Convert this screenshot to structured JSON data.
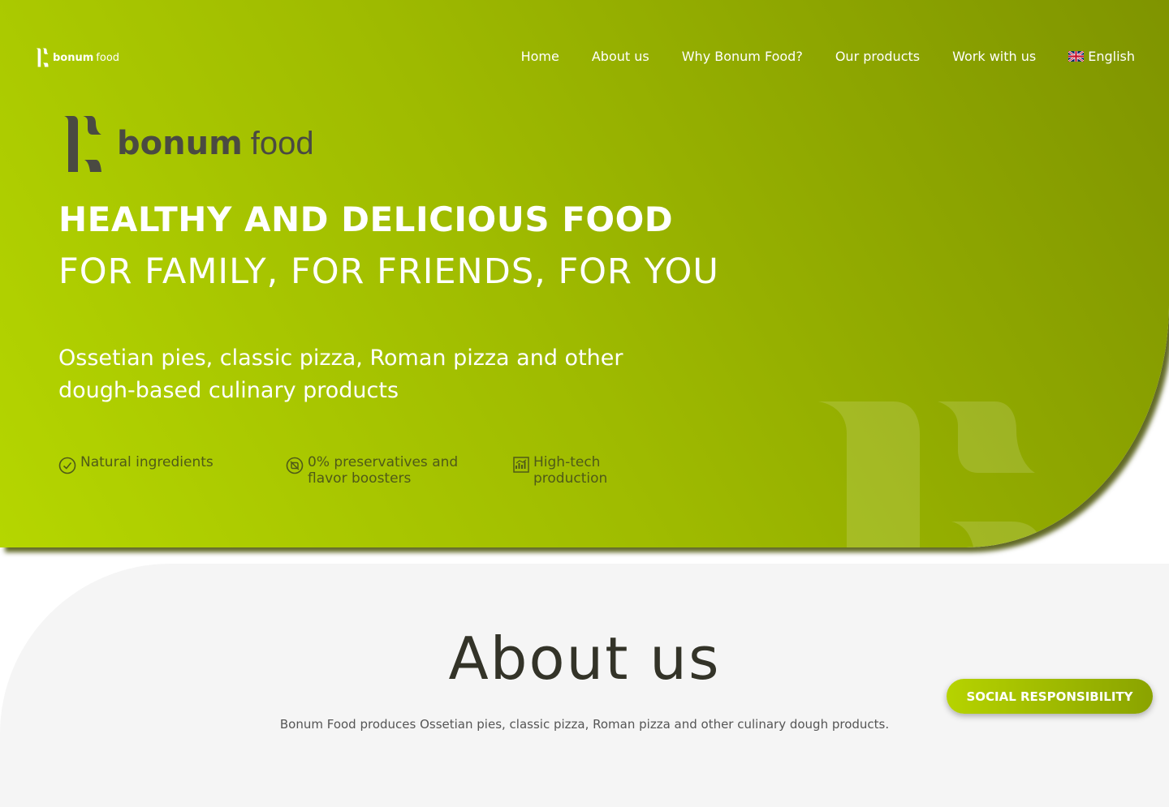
{
  "nav": {
    "logo_brand": "bonum",
    "logo_suffix": "food",
    "logo_icon": "bonum-food-logo-icon",
    "items": [
      {
        "label": "Home"
      },
      {
        "label": "About us"
      },
      {
        "label": "Why Bonum Food?"
      },
      {
        "label": "Our products"
      },
      {
        "label": "Work with us"
      }
    ],
    "language": {
      "label": "English",
      "icon": "uk-flag-icon"
    }
  },
  "hero": {
    "logo_brand": "bonum",
    "logo_suffix": "food",
    "headline": "HEALTHY AND DELICIOUS FOOD",
    "subheadline": "FOR FAMILY, FOR FRIENDS, FOR YOU",
    "description": "Ossetian pies, classic pizza, Roman pizza and other dough-based culinary products",
    "features": [
      {
        "label": "Natural ingredients",
        "icon": "check-circle-icon"
      },
      {
        "label": "0% preservatives and flavor boosters",
        "icon": "zero-circle-icon"
      },
      {
        "label": "High-tech production",
        "icon": "chart-icon"
      }
    ],
    "colors": {
      "gradient_start": "#b5d600",
      "gradient_end": "#7f9400"
    }
  },
  "about": {
    "title": "About us",
    "text": "Bonum Food produces Ossetian pies, classic pizza, Roman pizza and other culinary dough products."
  },
  "social_button": {
    "label": "SOCIAL RESPONSIBILITY"
  }
}
